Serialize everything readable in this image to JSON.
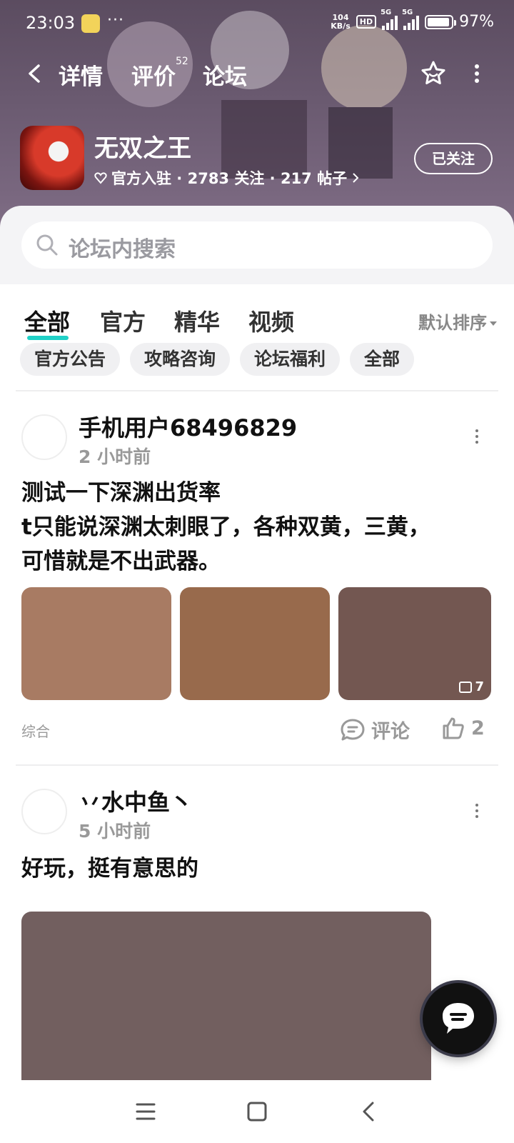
{
  "status_bar": {
    "time": "23:03",
    "dots": "···",
    "net_speed_top": "104",
    "net_speed_bottom": "KB/s",
    "hd": "HD",
    "signal1": "5G",
    "signal2": "5G",
    "battery_pct": "97%"
  },
  "nav": {
    "tabs": [
      {
        "label": "详情"
      },
      {
        "label": "评价",
        "count": "52"
      },
      {
        "label": "论坛"
      }
    ]
  },
  "game": {
    "name": "无双之王",
    "meta": "官方入驻 · 2783 关注 · 217 帖子",
    "follow_button": "已关注"
  },
  "search": {
    "placeholder": "论坛内搜索"
  },
  "filter_tabs": [
    "全部",
    "官方",
    "精华",
    "视频"
  ],
  "sort_label": "默认排序",
  "chips": [
    "官方公告",
    "攻略咨询",
    "论坛福利",
    "全部"
  ],
  "posts": [
    {
      "user": "手机用户68496829",
      "time": "2 小时前",
      "text_lines": [
        "测试一下深渊出货率",
        "t只能说深渊太刺眼了，各种双黄，三黄，",
        "可惜就是不出武器。"
      ],
      "image_count": "7",
      "tag": "综合",
      "comment_label": "评论",
      "like_count": "2"
    },
    {
      "user": "丷水中鱼丶",
      "time": "5 小时前",
      "text_lines": [
        "好玩，挺有意思的"
      ]
    }
  ],
  "colors": {
    "accent": "#20d1c7",
    "img1": "#a87b63",
    "img2": "#986a4c",
    "img3": "#735751",
    "img4": "#725f5f"
  }
}
